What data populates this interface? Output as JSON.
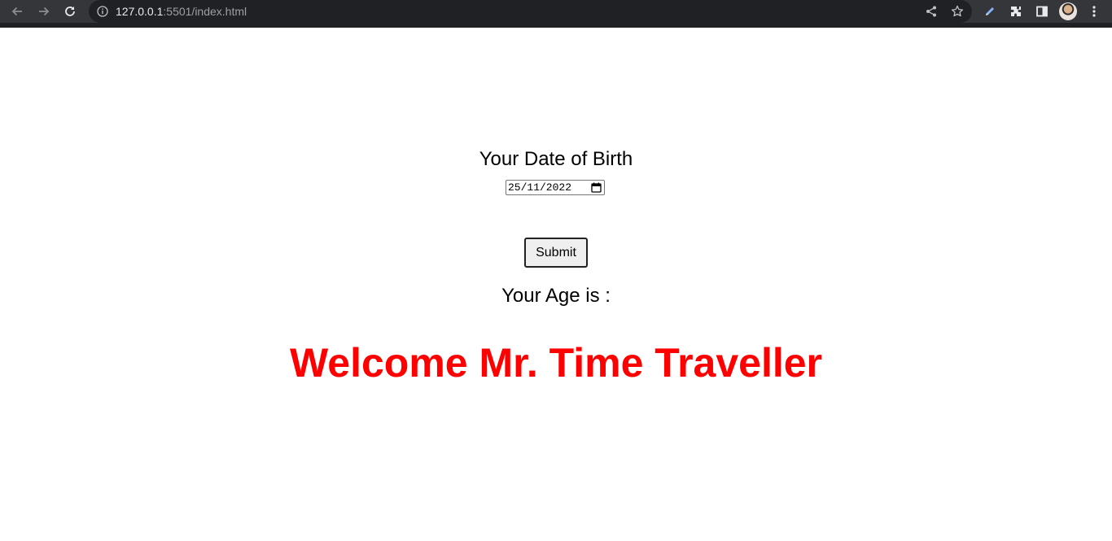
{
  "browser": {
    "url_host": "127.0.0.1",
    "url_rest": ":5501/index.html",
    "icons": [
      "back-icon",
      "forward-icon",
      "reload-icon",
      "site-info-icon",
      "share-icon",
      "bookmark-star-icon",
      "pen-icon",
      "extensions-icon",
      "side-panel-icon",
      "avatar",
      "menu-icon"
    ]
  },
  "form": {
    "dob_label": "Your Date of Birth",
    "date_value": "25/11/2022",
    "submit_label": "Submit",
    "age_label": "Your Age is :"
  },
  "message": {
    "text": "Welcome Mr. Time Traveller",
    "color": "#ff0000"
  }
}
